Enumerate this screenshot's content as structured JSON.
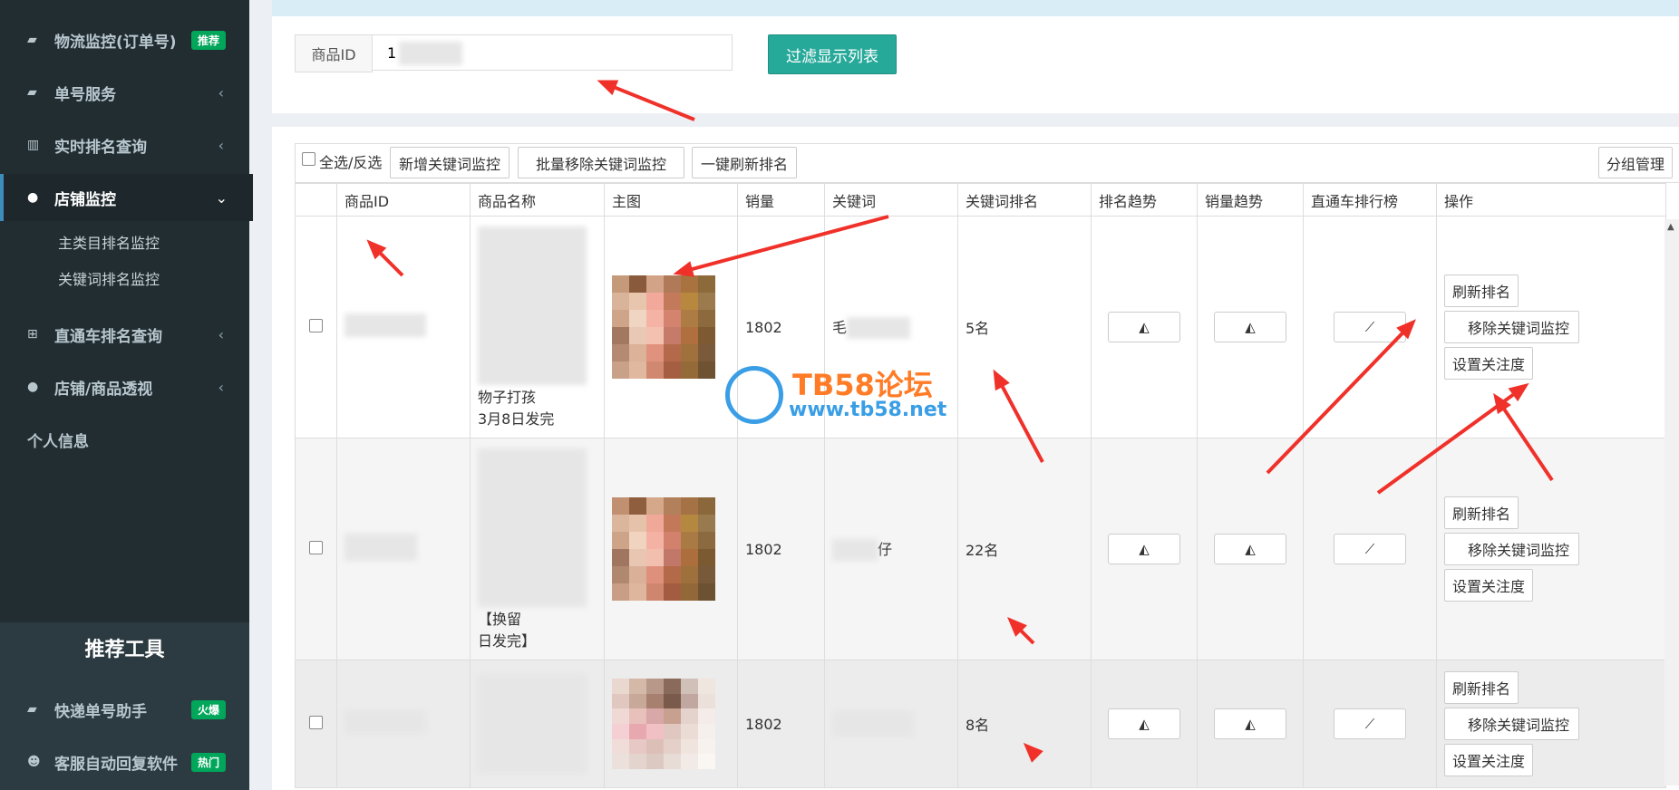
{
  "sidebar": {
    "items": [
      {
        "icon": "truck-icon",
        "label": "物流监控(订单号)",
        "badge": "推荐"
      },
      {
        "icon": "truck-icon",
        "label": "单号服务",
        "chevron": "‹"
      },
      {
        "icon": "bar-chart-icon",
        "label": "实时排名查询",
        "chevron": "‹"
      },
      {
        "icon": "globe-icon",
        "label": "店铺监控",
        "chevron": "⌄"
      },
      {
        "icon": "cart-icon",
        "label": "直通车排名查询",
        "chevron": "‹"
      },
      {
        "icon": "globe-icon",
        "label": "店铺/商品透视",
        "chevron": "‹"
      },
      {
        "label": "个人信息"
      }
    ],
    "sub_items": [
      "主类目排名监控",
      "关键词排名监控"
    ],
    "tools_title": "推荐工具",
    "tools": [
      {
        "icon": "truck-icon",
        "label": "快递单号助手",
        "badge": "火爆"
      },
      {
        "icon": "users-icon",
        "label": "客服自动回复软件",
        "badge": "热门"
      }
    ]
  },
  "filter": {
    "label": "商品ID",
    "value": "1",
    "button": "过滤显示列表"
  },
  "toolbar": {
    "select_all": "全选/反选",
    "add_btn": "新增关键词监控",
    "batch_remove_btn": "批量移除关键词监控",
    "refresh_all_btn": "一键刷新排名",
    "group_btn": "分组管理"
  },
  "table": {
    "headers": [
      "商品ID",
      "商品名称",
      "主图",
      "销量",
      "关键词",
      "关键词排名",
      "排名趋势",
      "销量趋势",
      "直通车排行榜",
      "操作"
    ],
    "rows": [
      {
        "name_tail": "物子打孩",
        "name_date": "3月8日发完",
        "sales": "1802",
        "keyword": "毛",
        "rank": "5名"
      },
      {
        "name_tail": "【换留",
        "name_date": "日发完】",
        "sales": "1802",
        "keyword": "仔",
        "rank": "22名"
      },
      {
        "name_tail": "",
        "name_date": "",
        "sales": "1802",
        "keyword": "",
        "rank": "8名"
      }
    ],
    "ops": {
      "refresh": "刷新排名",
      "remove": "移除关键词监控",
      "follow": "设置关注度"
    }
  },
  "watermark": {
    "title": "TB58论坛",
    "url": "www.tb58.net"
  },
  "colors": {
    "sidebar": "#222d32",
    "accent": "#27a99a",
    "badge": "#00a65a",
    "arrow": "#f0312a"
  }
}
